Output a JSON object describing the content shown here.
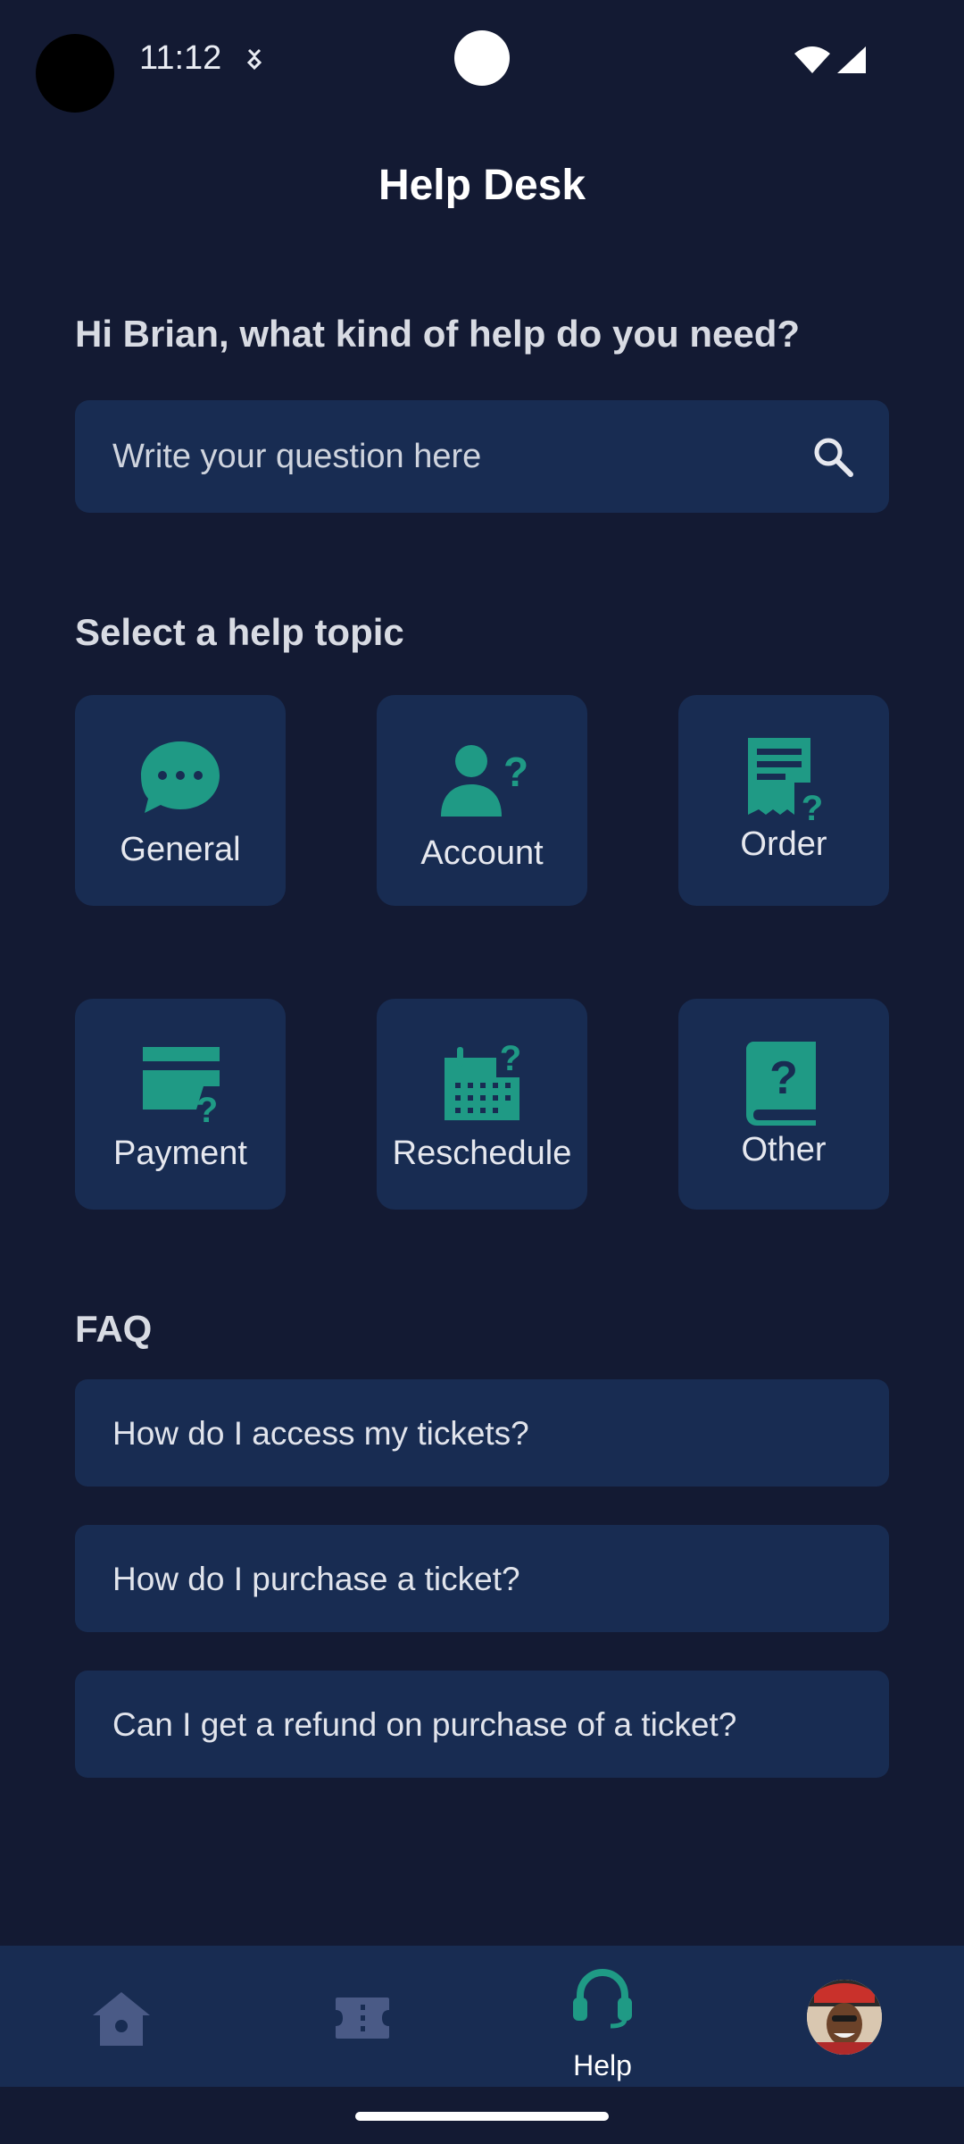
{
  "status_bar": {
    "time": "11:12"
  },
  "header": {
    "title": "Help Desk"
  },
  "greeting": "Hi Brian, what kind of help do you need?",
  "search": {
    "placeholder": "Write your question here"
  },
  "topics": {
    "heading": "Select a help topic",
    "items": [
      {
        "label": "General",
        "icon": "chat-bubble-icon"
      },
      {
        "label": "Account",
        "icon": "user-question-icon"
      },
      {
        "label": "Order",
        "icon": "receipt-question-icon"
      },
      {
        "label": "Payment",
        "icon": "card-question-icon"
      },
      {
        "label": "Reschedule",
        "icon": "calendar-question-icon"
      },
      {
        "label": "Other",
        "icon": "book-question-icon"
      }
    ]
  },
  "faq": {
    "heading": "FAQ",
    "items": [
      "How do I access my tickets?",
      "How do I purchase a ticket?",
      "Can I get a refund on purchase of a ticket?"
    ]
  },
  "bottom_nav": {
    "items": [
      {
        "icon": "home-icon",
        "label": ""
      },
      {
        "icon": "ticket-icon",
        "label": ""
      },
      {
        "icon": "headset-icon",
        "label": "Help",
        "active": true
      },
      {
        "icon": "avatar",
        "label": ""
      }
    ]
  },
  "colors": {
    "background": "#131a33",
    "card": "#182c52",
    "accent": "#1f9a85",
    "inactive_icon": "#4a5a86"
  }
}
